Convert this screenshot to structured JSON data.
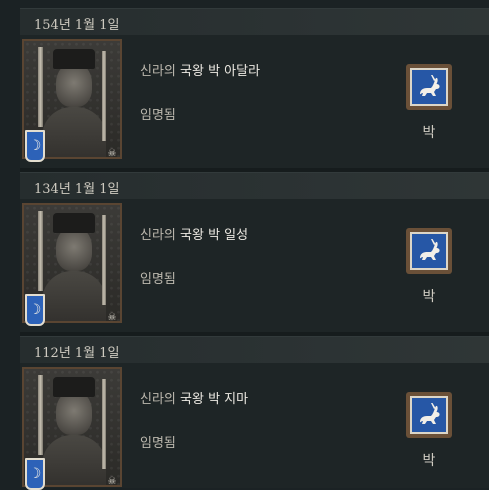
{
  "entries": [
    {
      "date": "154년 1월 1일",
      "title_prefix": "신라의",
      "title_rank": "국왕 박 아달라",
      "event": "임명됨",
      "house": "박",
      "shield_glyph": "☽",
      "skull_glyph": "☠",
      "coa_icon": "white-rabbit-icon"
    },
    {
      "date": "134년 1월 1일",
      "title_prefix": "신라의",
      "title_rank": "국왕 박 일성",
      "event": "임명됨",
      "house": "박",
      "shield_glyph": "☽",
      "skull_glyph": "☠",
      "coa_icon": "white-rabbit-icon"
    },
    {
      "date": "112년 1월 1일",
      "title_prefix": "신라의",
      "title_rank": "국왕 박 지마",
      "event": "임명됨",
      "house": "박",
      "shield_glyph": "☽",
      "skull_glyph": "☠",
      "coa_icon": "white-rabbit-icon"
    }
  ],
  "colors": {
    "coa_blue": "#2657a6",
    "shield_blue": "#2d62b8",
    "frame_brown": "#6a5038"
  }
}
